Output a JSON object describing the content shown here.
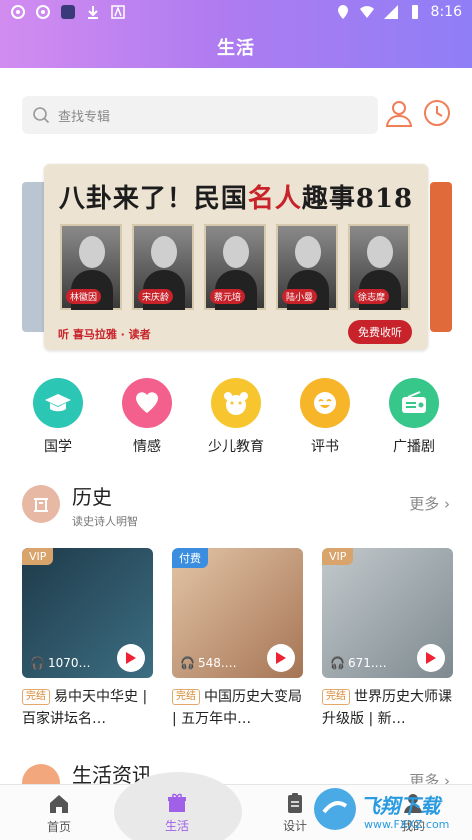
{
  "status_bar": {
    "time": "8:16"
  },
  "header": {
    "title": "生活"
  },
  "search": {
    "placeholder": "查找专辑"
  },
  "banner": {
    "title_a": "八卦来了！民国",
    "title_em": "名人",
    "title_b": "趣事818",
    "people": [
      "林徽因",
      "宋庆龄",
      "蔡元培",
      "陆小曼",
      "徐志摩"
    ],
    "brand": "听 喜马拉雅 · 读者",
    "cta": "免费收听"
  },
  "categories": [
    {
      "label": "国学",
      "color": "#2cc6b5",
      "icon": "graduation-cap-icon"
    },
    {
      "label": "情感",
      "color": "#f4608e",
      "icon": "heart-icon"
    },
    {
      "label": "少儿教育",
      "color": "#f7c52e",
      "icon": "bear-icon"
    },
    {
      "label": "评书",
      "color": "#f7b52a",
      "icon": "smile-icon"
    },
    {
      "label": "广播剧",
      "color": "#37c78a",
      "icon": "radio-icon"
    }
  ],
  "section_history": {
    "title": "历史",
    "subtitle": "读史诗人明智",
    "more": "更多",
    "cards": [
      {
        "tag": "VIP",
        "tag_color": "#d9a36c",
        "plays": "1070…",
        "status": "完结",
        "title": "易中天中华史 | 百家讲坛名…",
        "bg": "#2f5466"
      },
      {
        "tag": "付费",
        "tag_color": "#3b8de0",
        "plays": "548.…",
        "status": "完结",
        "title": "中国历史大变局 | 五万年中…",
        "bg": "#c89a78"
      },
      {
        "tag": "VIP",
        "tag_color": "#d9a36c",
        "plays": "671.…",
        "status": "完结",
        "title": "世界历史大师课升级版 | 新…",
        "bg": "#9aa3a8"
      }
    ]
  },
  "section_life": {
    "title": "生活资讯",
    "more": "更多"
  },
  "nav": {
    "items": [
      {
        "label": "首页"
      },
      {
        "label": "生活"
      },
      {
        "label": "设计"
      },
      {
        "label": "我的"
      }
    ],
    "active": "生活",
    "accent": "#a060e8"
  },
  "watermark": {
    "text": "飞翔下载",
    "url": "www.FXXZ.com"
  }
}
